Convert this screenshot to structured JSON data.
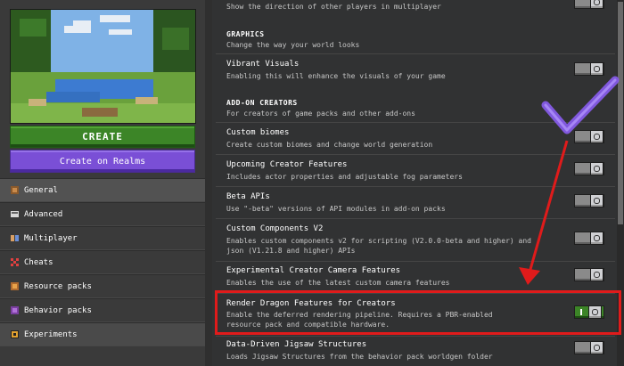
{
  "left": {
    "create_button": "CREATE",
    "realms_button": "Create on Realms",
    "nav": [
      {
        "label": "General",
        "icon": "gear-icon"
      },
      {
        "label": "Advanced",
        "icon": "advanced-icon"
      },
      {
        "label": "Multiplayer",
        "icon": "multiplayer-icon"
      },
      {
        "label": "Cheats",
        "icon": "cheats-icon"
      },
      {
        "label": "Resource packs",
        "icon": "resource-packs-icon"
      },
      {
        "label": "Behavior packs",
        "icon": "behavior-packs-icon"
      },
      {
        "label": "Experiments",
        "icon": "experiments-icon"
      }
    ]
  },
  "settings": {
    "top_row_desc": "Show the direction of other players in multiplayer",
    "graphics": {
      "header": "GRAPHICS",
      "desc": "Change the way your world looks"
    },
    "vibrant": {
      "title": "Vibrant Visuals",
      "desc": "Enabling this will enhance the visuals of your game"
    },
    "addon": {
      "header": "ADD-ON CREATORS",
      "desc": "For creators of game packs and other add-ons"
    },
    "items": [
      {
        "title": "Custom biomes",
        "desc": "Create custom biomes and change world generation"
      },
      {
        "title": "Upcoming Creator Features",
        "desc": "Includes actor properties and adjustable fog parameters"
      },
      {
        "title": "Beta APIs",
        "desc": "Use \"-beta\" versions of API modules in add-on packs"
      },
      {
        "title": "Custom Components V2",
        "desc": "Enables custom components v2 for scripting (V2.0.0-beta and higher) and json (V1.21.8 and higher) APIs"
      },
      {
        "title": "Experimental Creator Camera Features",
        "desc": "Enables the use of the latest custom camera features"
      },
      {
        "title": "Render Dragon Features for Creators",
        "desc": "Enable the deferred rendering pipeline. Requires a PBR-enabled resource pack and compatible hardware."
      },
      {
        "title": "Data-Driven Jigsaw Structures",
        "desc": "Loads Jigsaw Structures from the behavior pack worldgen folder"
      }
    ]
  },
  "colors": {
    "accent_green": "#3c8527",
    "realms_purple": "#7a4fd6",
    "highlight_red": "#e01b1b",
    "checkmark_purple": "#8a5cf0"
  }
}
